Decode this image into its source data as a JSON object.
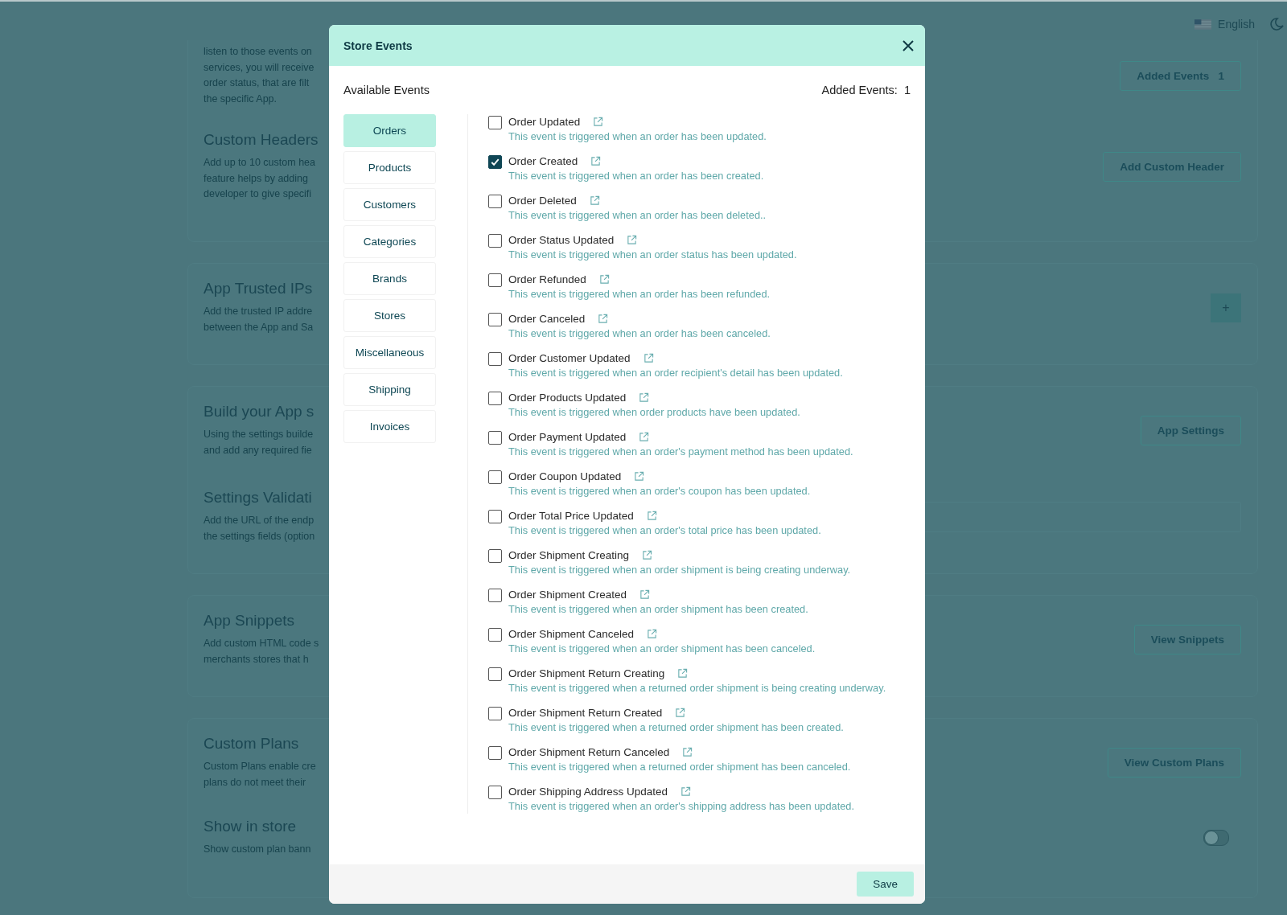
{
  "top_bar": {
    "language": "English"
  },
  "cards": [
    {
      "sections": [
        {
          "lines": [
            "listen to those events on",
            "services, you will receive",
            "order status, that are filt",
            "the specific App."
          ],
          "control": {
            "kind": "count_button",
            "label": "Added Events",
            "count": "1"
          }
        },
        {
          "title": "Custom Headers",
          "lines": [
            "Add up to 10 custom hea",
            "feature helps by adding",
            "developer to give specifi"
          ],
          "control": {
            "kind": "button",
            "label": "Add Custom Header"
          }
        }
      ]
    },
    {
      "sections": [
        {
          "title": "App Trusted IPs",
          "lines": [
            "Add the trusted IP addre",
            "between the App and Sa"
          ],
          "control": {
            "kind": "add_button",
            "label": "+"
          }
        }
      ]
    },
    {
      "sections": [
        {
          "title": "Build your App s",
          "lines": [
            "Using the settings builde",
            "and add any required fie"
          ],
          "control": {
            "kind": "button",
            "label": "App Settings"
          }
        },
        {
          "title": "Settings Validati",
          "lines": [
            "Add the URL of the endp",
            "the settings fields (option"
          ],
          "control": {
            "kind": "field"
          }
        }
      ]
    },
    {
      "sections": [
        {
          "title": "App Snippets",
          "lines": [
            "Add custom HTML code s",
            "merchants stores that h"
          ],
          "control": {
            "kind": "button",
            "label": "View Snippets"
          }
        }
      ]
    },
    {
      "sections": [
        {
          "title": "Custom Plans",
          "lines": [
            "Custom Plans enable cre",
            "plans do not meet their"
          ],
          "control": {
            "kind": "button",
            "label": "View Custom Plans"
          }
        },
        {
          "title": "Show in store",
          "lines": [
            "Show custom plan bann"
          ],
          "control": {
            "kind": "toggle",
            "on": false
          }
        }
      ]
    }
  ],
  "modal": {
    "title": "Store Events",
    "heading": "Available Events",
    "added_label": "Added Events:",
    "added_count": "1",
    "categories": [
      {
        "label": "Orders",
        "selected": true
      },
      {
        "label": "Products",
        "selected": false
      },
      {
        "label": "Customers",
        "selected": false
      },
      {
        "label": "Categories",
        "selected": false
      },
      {
        "label": "Brands",
        "selected": false
      },
      {
        "label": "Stores",
        "selected": false
      },
      {
        "label": "Miscellaneous",
        "selected": false
      },
      {
        "label": "Shipping",
        "selected": false
      },
      {
        "label": "Invoices",
        "selected": false
      }
    ],
    "events": [
      {
        "name": "Order Updated",
        "description": "This event is triggered when an order has been updated.",
        "checked": false
      },
      {
        "name": "Order Created",
        "description": "This event is triggered when an order has been created.",
        "checked": true
      },
      {
        "name": "Order Deleted",
        "description": "This event is triggered when an order has been deleted..",
        "checked": false
      },
      {
        "name": "Order Status Updated",
        "description": "This event is triggered when an order status has been updated.",
        "checked": false
      },
      {
        "name": "Order Refunded",
        "description": "This event is triggered when an order has been refunded.",
        "checked": false
      },
      {
        "name": "Order Canceled",
        "description": "This event is triggered when an order has been canceled.",
        "checked": false
      },
      {
        "name": "Order Customer Updated",
        "description": "This event is triggered when an order recipient's detail has been updated.",
        "checked": false
      },
      {
        "name": "Order Products Updated",
        "description": "This event is triggered when order products have been updated.",
        "checked": false
      },
      {
        "name": "Order Payment Updated",
        "description": "This event is triggered when an order's payment method has been updated.",
        "checked": false
      },
      {
        "name": "Order Coupon Updated",
        "description": "This event is triggered when an order's coupon has been updated.",
        "checked": false
      },
      {
        "name": "Order Total Price Updated",
        "description": "This event is triggered when an order's total price has been updated.",
        "checked": false
      },
      {
        "name": "Order Shipment Creating",
        "description": "This event is triggered when an order shipment is being creating underway.",
        "checked": false
      },
      {
        "name": "Order Shipment Created",
        "description": "This event is triggered when an order shipment has been created.",
        "checked": false
      },
      {
        "name": "Order Shipment Canceled",
        "description": "This event is triggered when an order shipment has been canceled.",
        "checked": false
      },
      {
        "name": "Order Shipment Return Creating",
        "description": "This event is triggered when a returned order shipment is being creating underway.",
        "checked": false
      },
      {
        "name": "Order Shipment Return Created",
        "description": "This event is triggered when a returned order shipment has been created.",
        "checked": false
      },
      {
        "name": "Order Shipment Return Canceled",
        "description": "This event is triggered when a returned order shipment has been canceled.",
        "checked": false
      },
      {
        "name": "Order Shipping Address Updated",
        "description": "This event is triggered when an order's shipping address has been updated.",
        "checked": false
      }
    ],
    "save": "Save"
  }
}
